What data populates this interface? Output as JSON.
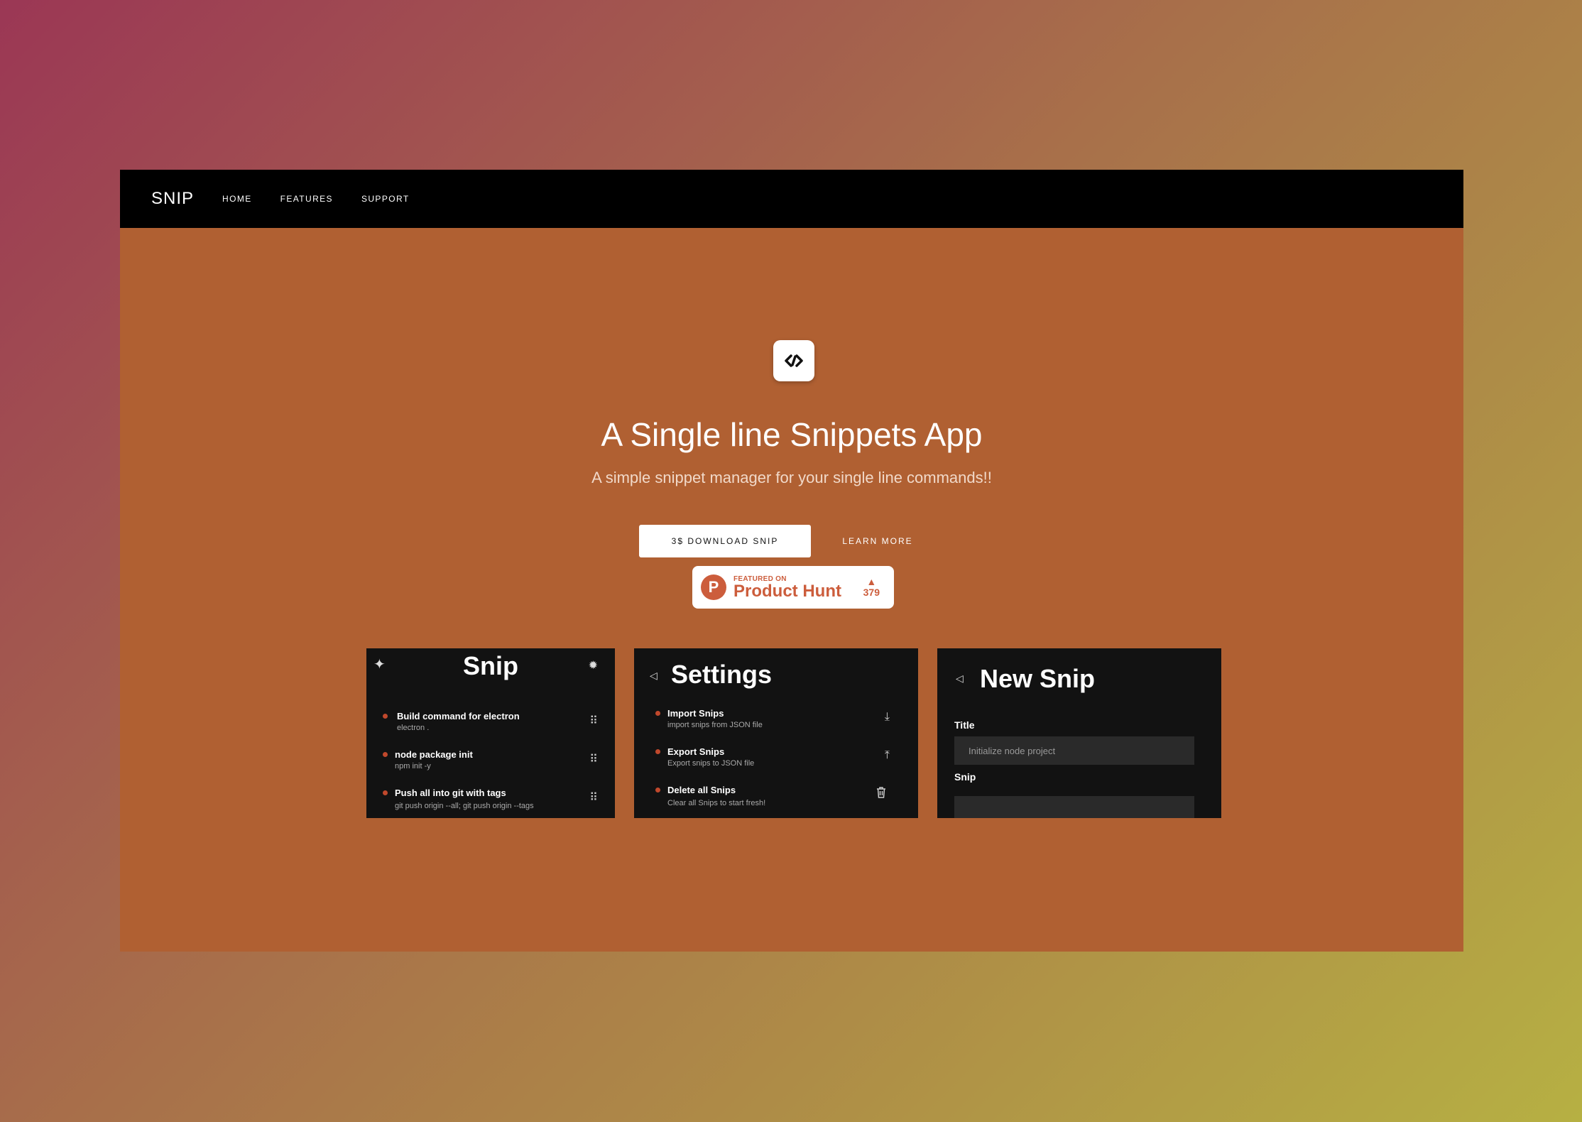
{
  "nav": {
    "brand": "SNIP",
    "links": [
      "HOME",
      "FEATURES",
      "SUPPORT"
    ]
  },
  "hero": {
    "title": "A Single line Snippets App",
    "subtitle": "A simple snippet manager for your single line commands!!",
    "download_label": "3$ DOWNLOAD SNIP",
    "learn_label": "LEARN MORE"
  },
  "product_hunt": {
    "featured": "FEATURED ON",
    "name": "Product Hunt",
    "count": "379",
    "letter": "P"
  },
  "shots": {
    "snip": {
      "title": "Snip",
      "items": [
        {
          "title": "Build command for electron",
          "sub": "electron ."
        },
        {
          "title": "node package init",
          "sub": "npm init -y"
        },
        {
          "title": "Push all into git with tags",
          "sub": "git push origin --all; git push origin --tags"
        }
      ]
    },
    "settings": {
      "title": "Settings",
      "items": [
        {
          "title": "Import Snips",
          "sub": "import snips from JSON file"
        },
        {
          "title": "Export Snips",
          "sub": "Export snips to JSON file"
        },
        {
          "title": "Delete all Snips",
          "sub": "Clear all Snips to start fresh!"
        }
      ]
    },
    "new_snip": {
      "title": "New Snip",
      "title_label": "Title",
      "title_value": "Initialize node project",
      "snip_label": "Snip"
    }
  },
  "colors": {
    "page_bg": "#b06032",
    "navbar": "#000000",
    "accent": "#cc5d3c"
  }
}
